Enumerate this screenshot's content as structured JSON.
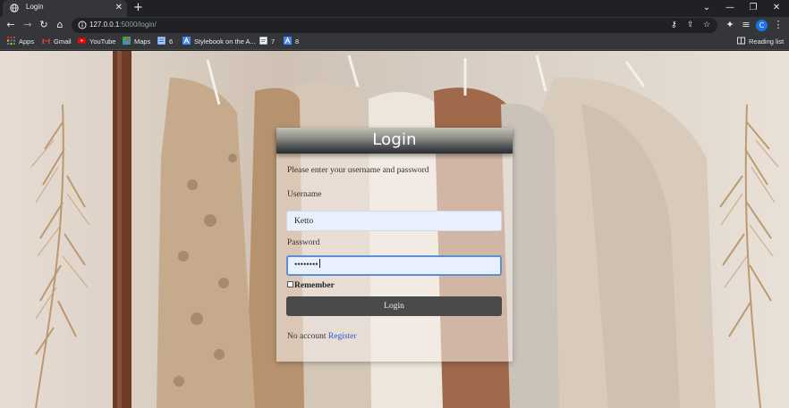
{
  "browser": {
    "tab": {
      "title": "Login",
      "close": "✕"
    },
    "new_tab": "+",
    "window": {
      "menu": "⌄",
      "minimize": "—",
      "restore": "❐",
      "close": "✕"
    },
    "nav": {
      "back": "←",
      "forward": "→",
      "reload": "↻",
      "home": "⌂"
    },
    "address": {
      "host": "127.0.0.1",
      "path": ":5000/login/"
    },
    "toolbar_icons": {
      "key": "⚷",
      "share": "⇪",
      "star": "☆",
      "extensions": "✦",
      "media": "≡",
      "avatar": "C",
      "menu": "⋮"
    },
    "bookmarks": [
      {
        "label": "Apps",
        "icon": "apps-grid-icon",
        "color": "#d93025"
      },
      {
        "label": "Gmail",
        "icon": "gmail-icon",
        "color": "#ea4335"
      },
      {
        "label": "YouTube",
        "icon": "youtube-icon",
        "color": "#ff0000"
      },
      {
        "label": "Maps",
        "icon": "maps-icon",
        "color": "#34a853"
      },
      {
        "label": "6",
        "icon": "doc-icon",
        "color": "#8ab4f8"
      },
      {
        "label": "Stylebook on the A...",
        "icon": "stylebook-icon",
        "color": "#4285f4"
      },
      {
        "label": "7",
        "icon": "page-icon",
        "color": "#e8eaed"
      },
      {
        "label": "8",
        "icon": "stylebook-icon",
        "color": "#4285f4"
      }
    ],
    "reading_list": "Reading list"
  },
  "login": {
    "title": "Login",
    "instructions": "Please enter your username and password",
    "username_label": "Username",
    "username_value": "Ketto",
    "password_label": "Password",
    "password_value": "••••••••",
    "remember_label": "Remember",
    "submit_label": "Login",
    "no_account_text": "No account",
    "register_link": "Register"
  }
}
